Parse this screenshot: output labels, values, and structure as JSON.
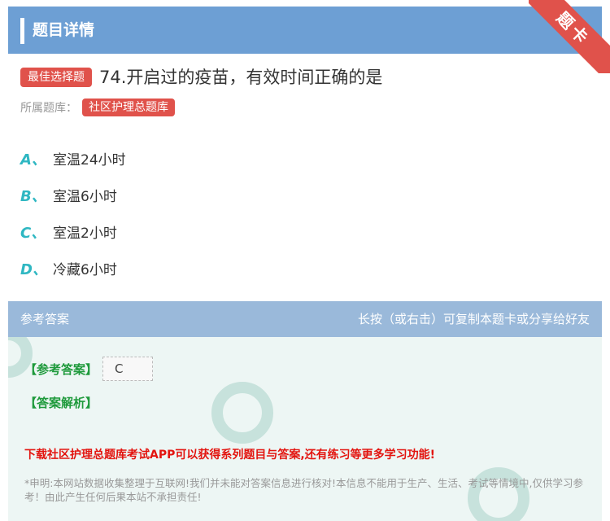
{
  "header": {
    "title": "题目详情"
  },
  "ribbon": {
    "label": "题卡"
  },
  "question": {
    "type_badge": "最佳选择题",
    "text": "74.开启过的疫苗，有效时间正确的是"
  },
  "bank": {
    "label": "所属题库：",
    "name": "社区护理总题库"
  },
  "options": [
    {
      "letter": "A、",
      "text": "室温24小时"
    },
    {
      "letter": "B、",
      "text": "室温6小时"
    },
    {
      "letter": "C、",
      "text": "室温2小时"
    },
    {
      "letter": "D、",
      "text": "冷藏6小时"
    }
  ],
  "answer_section": {
    "title": "参考答案",
    "hint": "长按（或右击）可复制本题卡或分享给好友",
    "ref_label": "【参考答案】",
    "ref_value": "C",
    "analysis_label": "【答案解析】",
    "promo": "下载社区护理总题库考试APP可以获得系列题目与答案,还有练习等更多学习功能!",
    "disclaimer": "*申明:本网站数据收集整理于互联网!我们并未能对答案信息进行核对!本信息不能用于生产、生活、考试等情境中,仅供学习参考！由此产生任何后果本站不承担责任!"
  },
  "colors": {
    "header_bg": "#6d9fd4",
    "badge_red": "#e0524b",
    "option_letter": "#2fb7c2",
    "answer_green": "#1f9a3c",
    "promo_red": "#e3140f"
  }
}
